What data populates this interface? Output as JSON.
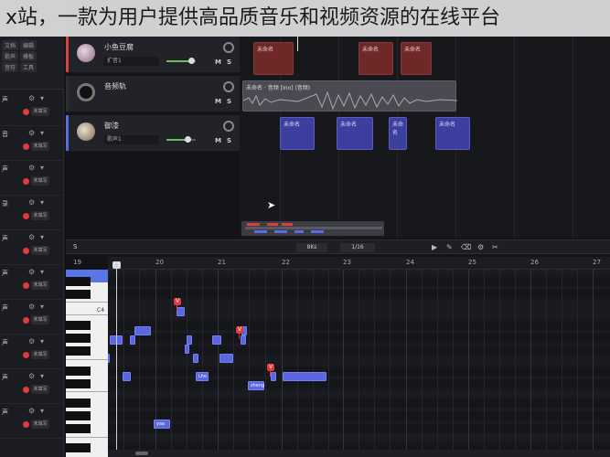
{
  "overlay": {
    "title": "x站，一款为用户提供高品质音乐和视频资源的在线平台"
  },
  "left_panel": {
    "top_tags": [
      "文档",
      "编辑",
      "歌声",
      "模板",
      "音符",
      "工具"
    ],
    "items": [
      {
        "label": "声",
        "btn": "未填写"
      },
      {
        "label": "音",
        "btn": "未填写"
      },
      {
        "label": "声",
        "btn": "未填写"
      },
      {
        "label": "录",
        "btn": "未填写"
      },
      {
        "label": "声",
        "btn": "未填写"
      },
      {
        "label": "声",
        "btn": "未填写"
      },
      {
        "label": "声",
        "btn": "未填写"
      },
      {
        "label": "声",
        "btn": "未填写"
      },
      {
        "label": "声",
        "btn": "未填写"
      },
      {
        "label": "声",
        "btn": "未填写"
      }
    ]
  },
  "tracks": [
    {
      "name": "小鱼豆腐",
      "select": "扩音1",
      "mute": "M",
      "solo": "S",
      "accent": "#d9413f",
      "volume_pct": 80
    },
    {
      "name": "音频轨",
      "select": "",
      "mute": "M",
      "solo": "S",
      "accent": "#2d2e33",
      "volume_pct": 0
    },
    {
      "name": "御漆",
      "select": "歌声1",
      "mute": "M",
      "solo": "S",
      "accent": "#5b6be0",
      "volume_pct": 70
    }
  ],
  "arrangement": {
    "red_clips": [
      "未命名",
      "未命名",
      "未命名"
    ],
    "audio_clip": "未命名 · 音频 [Ino] (音频)",
    "blue_clips": [
      "未命名",
      "未命名",
      "未命名",
      "未命名"
    ]
  },
  "piano_toolbar": {
    "s_label": "S",
    "tempo": "8Ks",
    "quant": "1/16",
    "tools": [
      "▶",
      "✎",
      "⌫",
      "⚙",
      "✂"
    ]
  },
  "piano_ruler": {
    "ticks": [
      "19",
      "20",
      "21",
      "22",
      "23",
      "24",
      "25",
      "26",
      "27"
    ]
  },
  "keyboard": {
    "c4_label": "C4"
  },
  "notes": [
    "",
    "",
    "",
    "",
    "",
    "",
    "",
    "",
    "",
    "",
    "",
    "",
    "",
    "zheng",
    "Lho",
    "",
    "",
    "yaa"
  ],
  "vmark": "V",
  "colors": {
    "note": "#5a67e0",
    "red_clip": "#6e2828",
    "accent_red": "#e0393e"
  }
}
